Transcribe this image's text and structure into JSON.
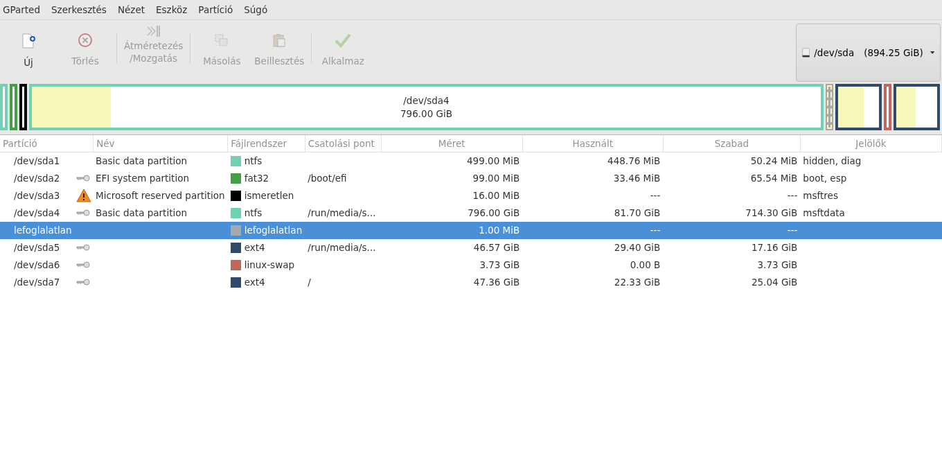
{
  "menu": [
    "GParted",
    "Szerkesztés",
    "Nézet",
    "Eszköz",
    "Partíció",
    "Súgó"
  ],
  "toolbar": [
    {
      "kind": "new",
      "label": "Új",
      "disabled": false
    },
    {
      "kind": "delete",
      "label": "Törlés",
      "disabled": true
    },
    {
      "kind": "separator"
    },
    {
      "kind": "resize",
      "label": "Átméretezés\n/Mozgatás",
      "disabled": true
    },
    {
      "kind": "separator"
    },
    {
      "kind": "copy",
      "label": "Másolás",
      "disabled": true
    },
    {
      "kind": "paste",
      "label": "Beillesztés",
      "disabled": true
    },
    {
      "kind": "separator"
    },
    {
      "kind": "apply",
      "label": "Alkalmaz",
      "disabled": true
    }
  ],
  "device": {
    "name": "/dev/sda",
    "size": "(894.25 GiB)"
  },
  "disk_map": [
    {
      "kind": "small",
      "color": "#70d2b1"
    },
    {
      "kind": "small",
      "color": "#42a044"
    },
    {
      "kind": "small",
      "color": "#000000"
    },
    {
      "kind": "large",
      "color": "#70d2b1",
      "level": 0.1,
      "title": "/dev/sda4",
      "subtitle": "796.00 GiB"
    },
    {
      "kind": "unallocated",
      "color": "#a9a9a9"
    },
    {
      "kind": "medium",
      "color": "#2f4a6b",
      "level": 0.62
    },
    {
      "kind": "small",
      "color": "#c1665a"
    },
    {
      "kind": "medium",
      "color": "#2f4a6b",
      "level": 0.47
    }
  ],
  "table": {
    "columns": [
      "Partíció",
      "Név",
      "Fájlrendszer",
      "Csatolási pont",
      "Méret",
      "Használt",
      "Szabad",
      "Jelölők"
    ],
    "rows": [
      {
        "partition": "/dev/sda1",
        "kind": "normal",
        "name": "Basic data partition",
        "fs": "ntfs",
        "color": "#70d2b1",
        "mount": "",
        "size": "499.00 MiB",
        "used": "448.76 MiB",
        "free": "50.24 MiB",
        "flags": "hidden, diag",
        "selected": false
      },
      {
        "partition": "/dev/sda2",
        "kind": "mounted",
        "name": "EFI system partition",
        "fs": "fat32",
        "color": "#42a044",
        "mount": "/boot/efi",
        "size": "99.00 MiB",
        "used": "33.46 MiB",
        "free": "65.54 MiB",
        "flags": "boot, esp",
        "selected": false
      },
      {
        "partition": "/dev/sda3",
        "kind": "warning",
        "name": "Microsoft reserved partition",
        "fs": "ismeretlen",
        "color": "#000000",
        "mount": "",
        "size": "16.00 MiB",
        "used": "---",
        "free": "---",
        "flags": "msftres",
        "selected": false
      },
      {
        "partition": "/dev/sda4",
        "kind": "mounted",
        "name": "Basic data partition",
        "fs": "ntfs",
        "color": "#70d2b1",
        "mount": "/run/media/s...",
        "size": "796.00 GiB",
        "used": "81.70 GiB",
        "free": "714.30 GiB",
        "flags": "msftdata",
        "selected": false
      },
      {
        "partition": "lefoglalatlan",
        "kind": "normal",
        "name": "",
        "fs": "lefoglalatlan",
        "color": "#a9a9a9",
        "mount": "",
        "size": "1.00 MiB",
        "used": "---",
        "free": "---",
        "flags": "",
        "selected": true
      },
      {
        "partition": "/dev/sda5",
        "kind": "mounted",
        "name": "",
        "fs": "ext4",
        "color": "#2f4a6b",
        "mount": "/run/media/s...",
        "size": "46.57 GiB",
        "used": "29.40 GiB",
        "free": "17.16 GiB",
        "flags": "",
        "selected": false
      },
      {
        "partition": "/dev/sda6",
        "kind": "mounted",
        "name": "",
        "fs": "linux-swap",
        "color": "#c1665a",
        "mount": "",
        "size": "3.73 GiB",
        "used": "0.00 B",
        "free": "3.73 GiB",
        "flags": "",
        "selected": false
      },
      {
        "partition": "/dev/sda7",
        "kind": "mounted",
        "name": "",
        "fs": "ext4",
        "color": "#2f4a6b",
        "mount": "/",
        "size": "47.36 GiB",
        "used": "22.33 GiB",
        "free": "25.04 GiB",
        "flags": "",
        "selected": false
      }
    ]
  }
}
